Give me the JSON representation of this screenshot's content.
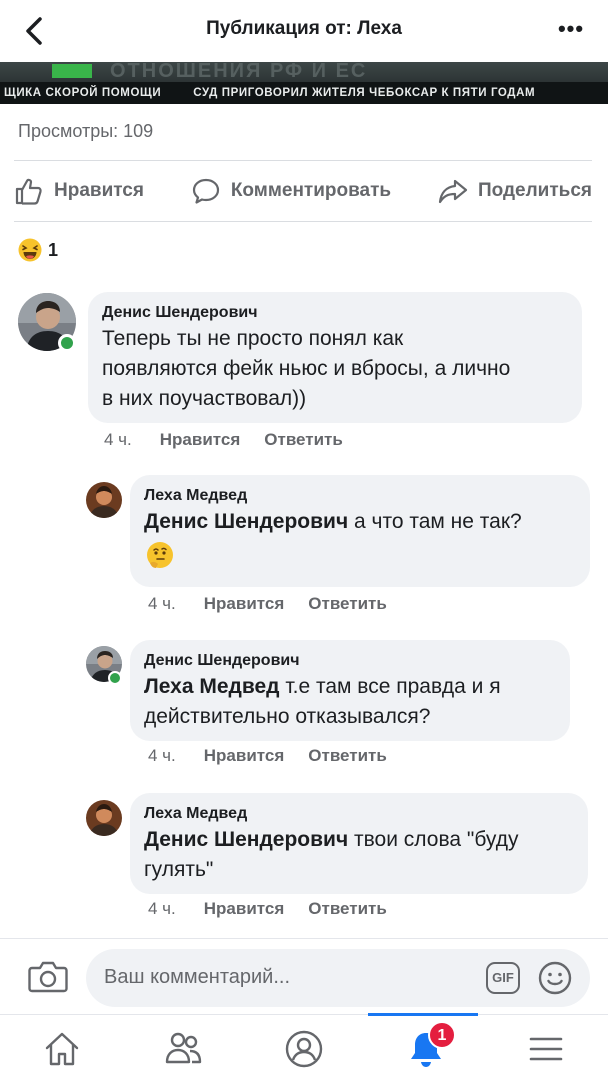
{
  "header": {
    "title": "Публикация от: Леха",
    "more_label": "•••"
  },
  "video": {
    "banner_text": "ОТНОШЕНИЯ РФ И ЕС",
    "ticker_left": "ЩИКА СКОРОЙ ПОМОЩИ",
    "ticker_right": "СУД ПРИГОВОРИЛ ЖИТЕЛЯ ЧЕБОКСАР К ПЯТИ ГОДАМ"
  },
  "post": {
    "views": "Просмотры: 109",
    "actions": {
      "like": "Нравится",
      "comment": "Комментировать",
      "share": "Поделиться"
    },
    "reaction_count": "1"
  },
  "comments": [
    {
      "author": "Денис Шендерович",
      "text": "Теперь ты не просто понял как появляются фейк ньюс и вбросы, а лично в них поучаствовал))",
      "line1": "Теперь ты не просто понял как",
      "line2": "появляются фейк ньюс и вбросы, а лично",
      "line3": "в них поучаствовал))",
      "time": "4 ч.",
      "like": "Нравится",
      "reply": "Ответить",
      "online": true
    },
    {
      "author": "Леха Медвед",
      "mention": "Денис Шендерович",
      "text": " а что там не так?",
      "emoji": "thinking-face",
      "time": "4 ч.",
      "like": "Нравится",
      "reply": "Ответить"
    },
    {
      "author": "Денис Шендерович",
      "mention": "Леха Медвед",
      "text": " т.е там все правда и я",
      "text2": "действительно отказывался?",
      "time": "4 ч.",
      "like": "Нравится",
      "reply": "Ответить",
      "online": true
    },
    {
      "author": "Леха Медвед",
      "mention": "Денис Шендерович",
      "text": " твои слова \"буду",
      "text2": "гулять\"",
      "time": "4 ч.",
      "like": "Нравится",
      "reply": "Ответить"
    }
  ],
  "composer": {
    "placeholder": "Ваш комментарий...",
    "gif_label": "GIF"
  },
  "tabbar": {
    "notifications_badge": "1",
    "active_tab": "notifications"
  },
  "colors": {
    "accent": "#1877f2",
    "badge": "#e41e3f",
    "online": "#31a24c",
    "bubble": "#f0f2f5",
    "secondary_text": "#65676b"
  }
}
